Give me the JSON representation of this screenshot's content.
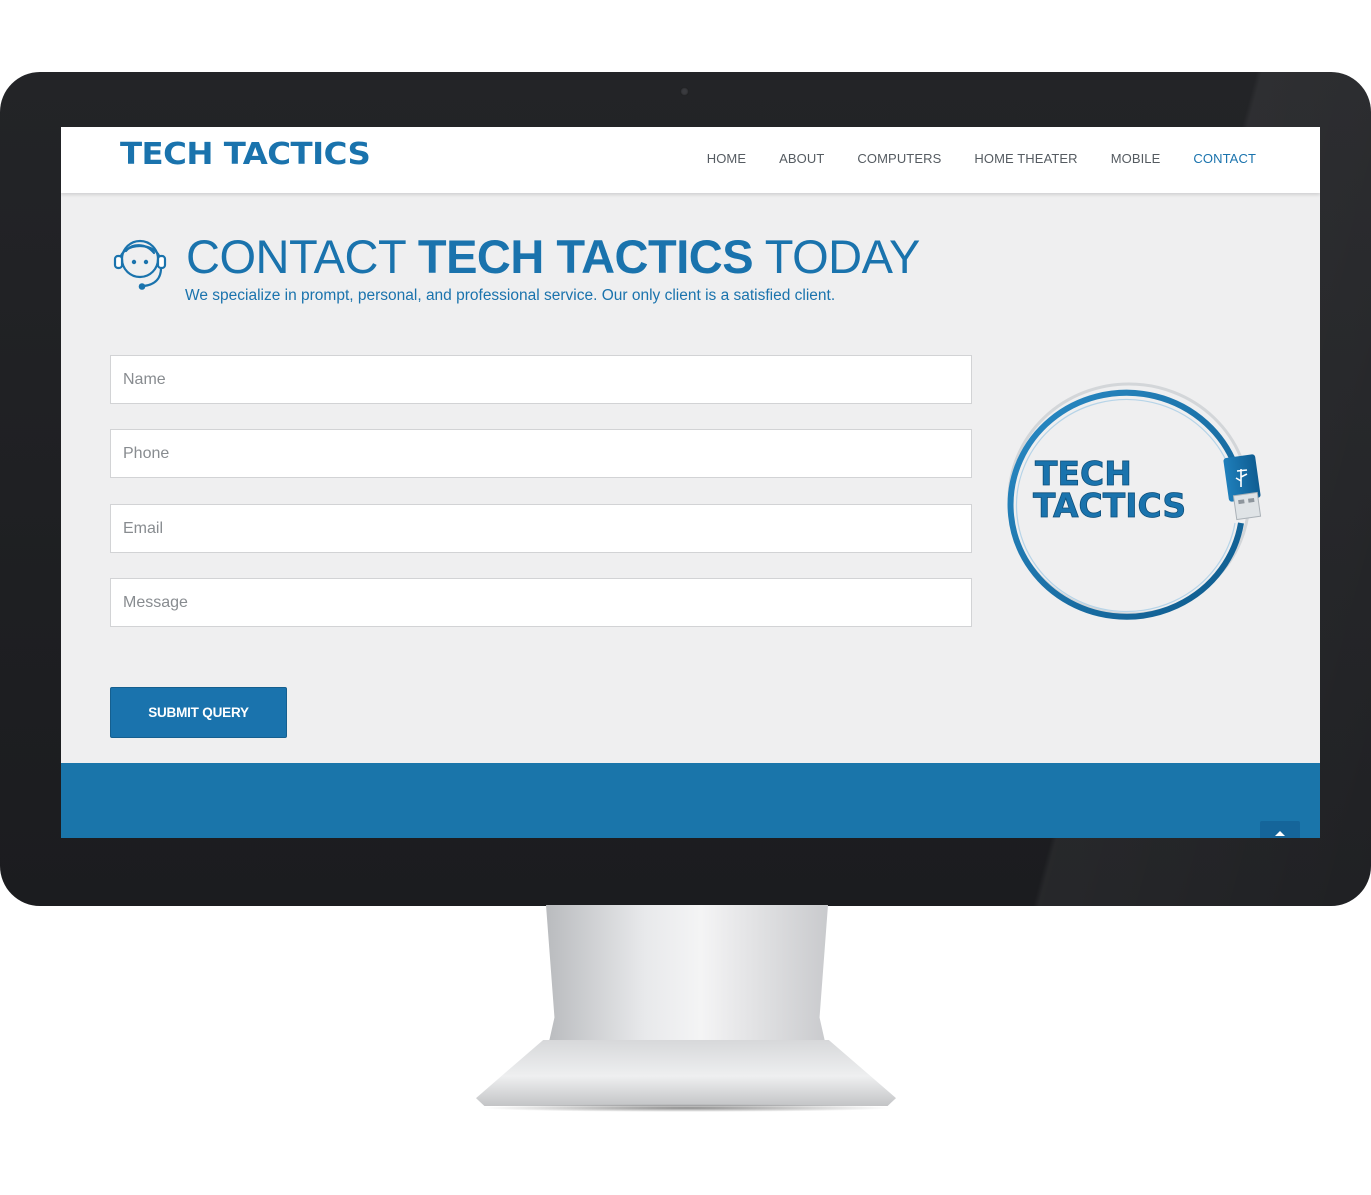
{
  "header": {
    "brand": "TECH TACTICS",
    "nav": [
      {
        "label": "HOME",
        "active": false
      },
      {
        "label": "ABOUT",
        "active": false
      },
      {
        "label": "COMPUTERS",
        "active": false
      },
      {
        "label": "HOME THEATER",
        "active": false
      },
      {
        "label": "MOBILE",
        "active": false
      },
      {
        "label": "CONTACT",
        "active": true
      }
    ]
  },
  "hero": {
    "icon": "headset-support-icon",
    "headline_pre": "CONTACT ",
    "headline_bold": "TECH TACTICS",
    "headline_post": " TODAY",
    "tagline": "We specialize in prompt, personal, and professional service. Our only client is a satisfied client."
  },
  "form": {
    "name_placeholder": "Name",
    "phone_placeholder": "Phone",
    "email_placeholder": "Email",
    "message_placeholder": "Message",
    "submit_label": "SUBMIT QUERY"
  },
  "logo_badge": {
    "line1": "TECH",
    "line2": "TACTICS",
    "icon": "usb-cable-ring-icon"
  },
  "footer": {
    "back_to_top_icon": "chevron-up-icon"
  },
  "colors": {
    "brand_blue": "#1a73ad",
    "footer_blue": "#1a75aa",
    "page_bg": "#efeff0",
    "bezel": "#1b1c1f"
  }
}
